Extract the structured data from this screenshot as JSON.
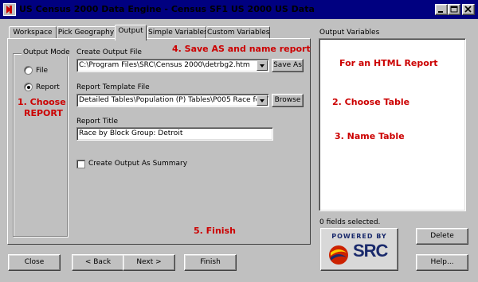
{
  "window": {
    "title": "US Census 2000 Data Engine - Census SF1 US 2000 US Data"
  },
  "tabs": [
    "Workspace",
    "Pick Geography",
    "Output",
    "Simple Variables",
    "Custom Variables"
  ],
  "output_mode": {
    "group_label": "Output Mode",
    "options": [
      "File",
      "Report"
    ],
    "selected": "Report"
  },
  "create_output_file": {
    "label": "Create Output File",
    "value": "C:\\Program Files\\SRC\\Census 2000\\detrbg2.htm",
    "save_as_label": "Save As"
  },
  "report_template_file": {
    "label": "Report Template File",
    "value": "Detailed Tables\\Population (P) Tables\\P005 Race for T",
    "browse_label": "Browse"
  },
  "report_title": {
    "label": "Report Title",
    "value": "Race by Block Group: Detroit"
  },
  "create_summary_label": "Create Output As Summary",
  "output_variables": {
    "label": "Output Variables",
    "status": "0 fields selected."
  },
  "annotations": {
    "choose_report_1": "1. Choose",
    "choose_report_2": "REPORT",
    "save_as": "4. Save AS and name report",
    "html_report": "For an HTML Report",
    "choose_table": "2. Choose Table",
    "name_table": "3. Name Table",
    "finish": "5. Finish"
  },
  "logo": {
    "powered_by": "POWERED BY",
    "brand": "SRC"
  },
  "buttons": {
    "close": "Close",
    "back": "< Back",
    "next": "Next >",
    "finish": "Finish",
    "delete": "Delete",
    "help": "Help..."
  },
  "colors": {
    "titlebar": "#000080",
    "annotation": "#cc0000",
    "logo_red": "#cc2200",
    "logo_navy": "#1a2a6c"
  }
}
